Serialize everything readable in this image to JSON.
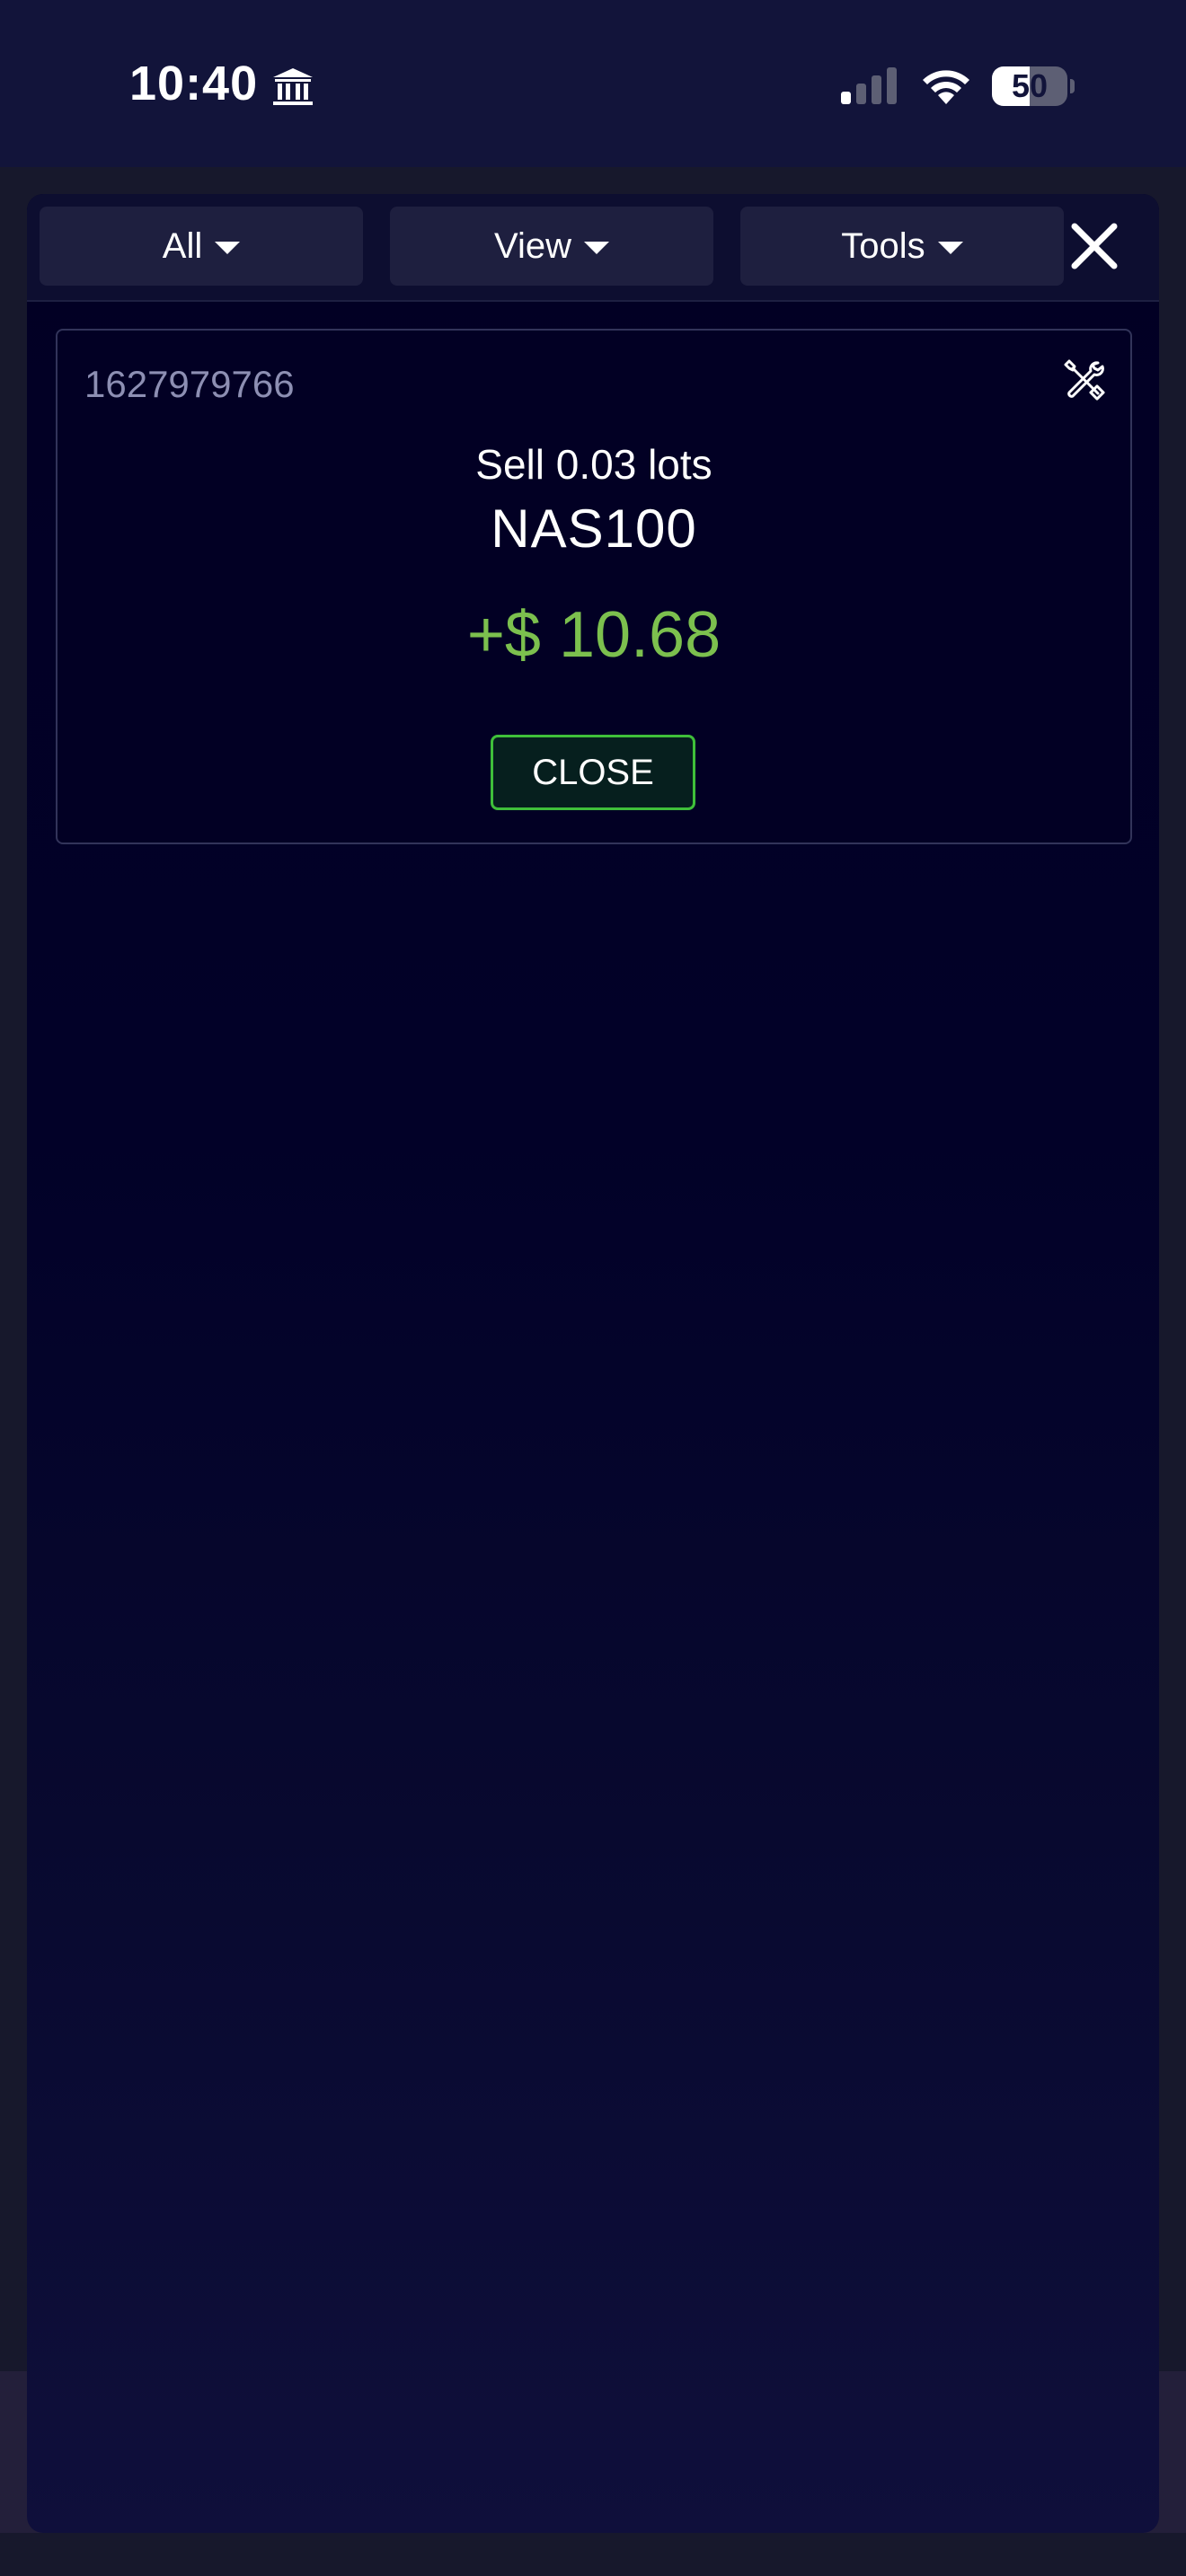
{
  "status_bar": {
    "time": "10:40",
    "battery": "50",
    "battery_level": 0.5,
    "icons": [
      "bank-icon",
      "cellular-signal-icon",
      "wifi-icon",
      "battery-icon"
    ]
  },
  "toolbar": {
    "filter_label": "All",
    "view_label": "View",
    "tools_label": "Tools",
    "icons": [
      "caret-down-icon",
      "close-icon"
    ]
  },
  "position": {
    "ticket_id": "1627979766",
    "side_text": "Sell 0.03 lots",
    "symbol": "NAS100",
    "pnl": "+$ 10.68",
    "close_label": "CLOSE",
    "icons": [
      "wrench-screwdriver-icon"
    ]
  },
  "colors": {
    "profit": "#7cc04e",
    "close_button_border": "#3fbf3a",
    "panel_background": "#020024",
    "toolbar_button": "#1e1f3f"
  }
}
